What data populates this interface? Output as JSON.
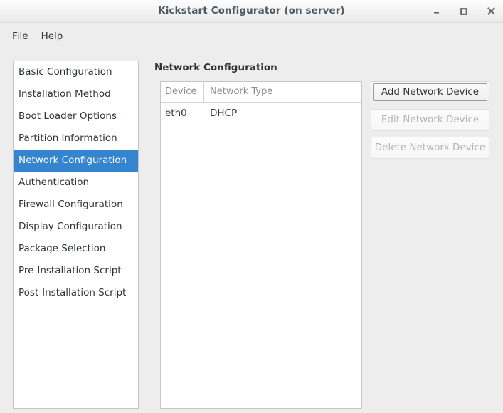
{
  "window": {
    "title": "Kickstart Configurator (on server)",
    "controls": [
      {
        "name": "minimize-button",
        "glyph": "minimize"
      },
      {
        "name": "maximize-button",
        "glyph": "maximize"
      },
      {
        "name": "close-button",
        "glyph": "close"
      }
    ]
  },
  "menubar": {
    "items": [
      {
        "label": "File"
      },
      {
        "label": "Help"
      }
    ]
  },
  "sidebar": {
    "items": [
      {
        "label": "Basic Configuration",
        "selected": false
      },
      {
        "label": "Installation Method",
        "selected": false
      },
      {
        "label": "Boot Loader Options",
        "selected": false
      },
      {
        "label": "Partition Information",
        "selected": false
      },
      {
        "label": "Network Configuration",
        "selected": true
      },
      {
        "label": "Authentication",
        "selected": false
      },
      {
        "label": "Firewall Configuration",
        "selected": false
      },
      {
        "label": "Display Configuration",
        "selected": false
      },
      {
        "label": "Package Selection",
        "selected": false
      },
      {
        "label": "Pre-Installation Script",
        "selected": false
      },
      {
        "label": "Post-Installation Script",
        "selected": false
      }
    ]
  },
  "main": {
    "heading": "Network Configuration",
    "table": {
      "columns": [
        "Device",
        "Network Type"
      ],
      "rows": [
        {
          "device": "eth0",
          "network_type": "DHCP"
        }
      ]
    },
    "buttons": [
      {
        "label": "Add Network Device",
        "state": "focused"
      },
      {
        "label": "Edit Network Device",
        "state": "disabled"
      },
      {
        "label": "Delete Network Device",
        "state": "disabled"
      }
    ]
  },
  "colors": {
    "selection": "#3584cf",
    "window_background": "#ededed",
    "panel_background": "#ffffff",
    "title_text": "#4c5862",
    "disabled_text": "#b4b4b4"
  }
}
